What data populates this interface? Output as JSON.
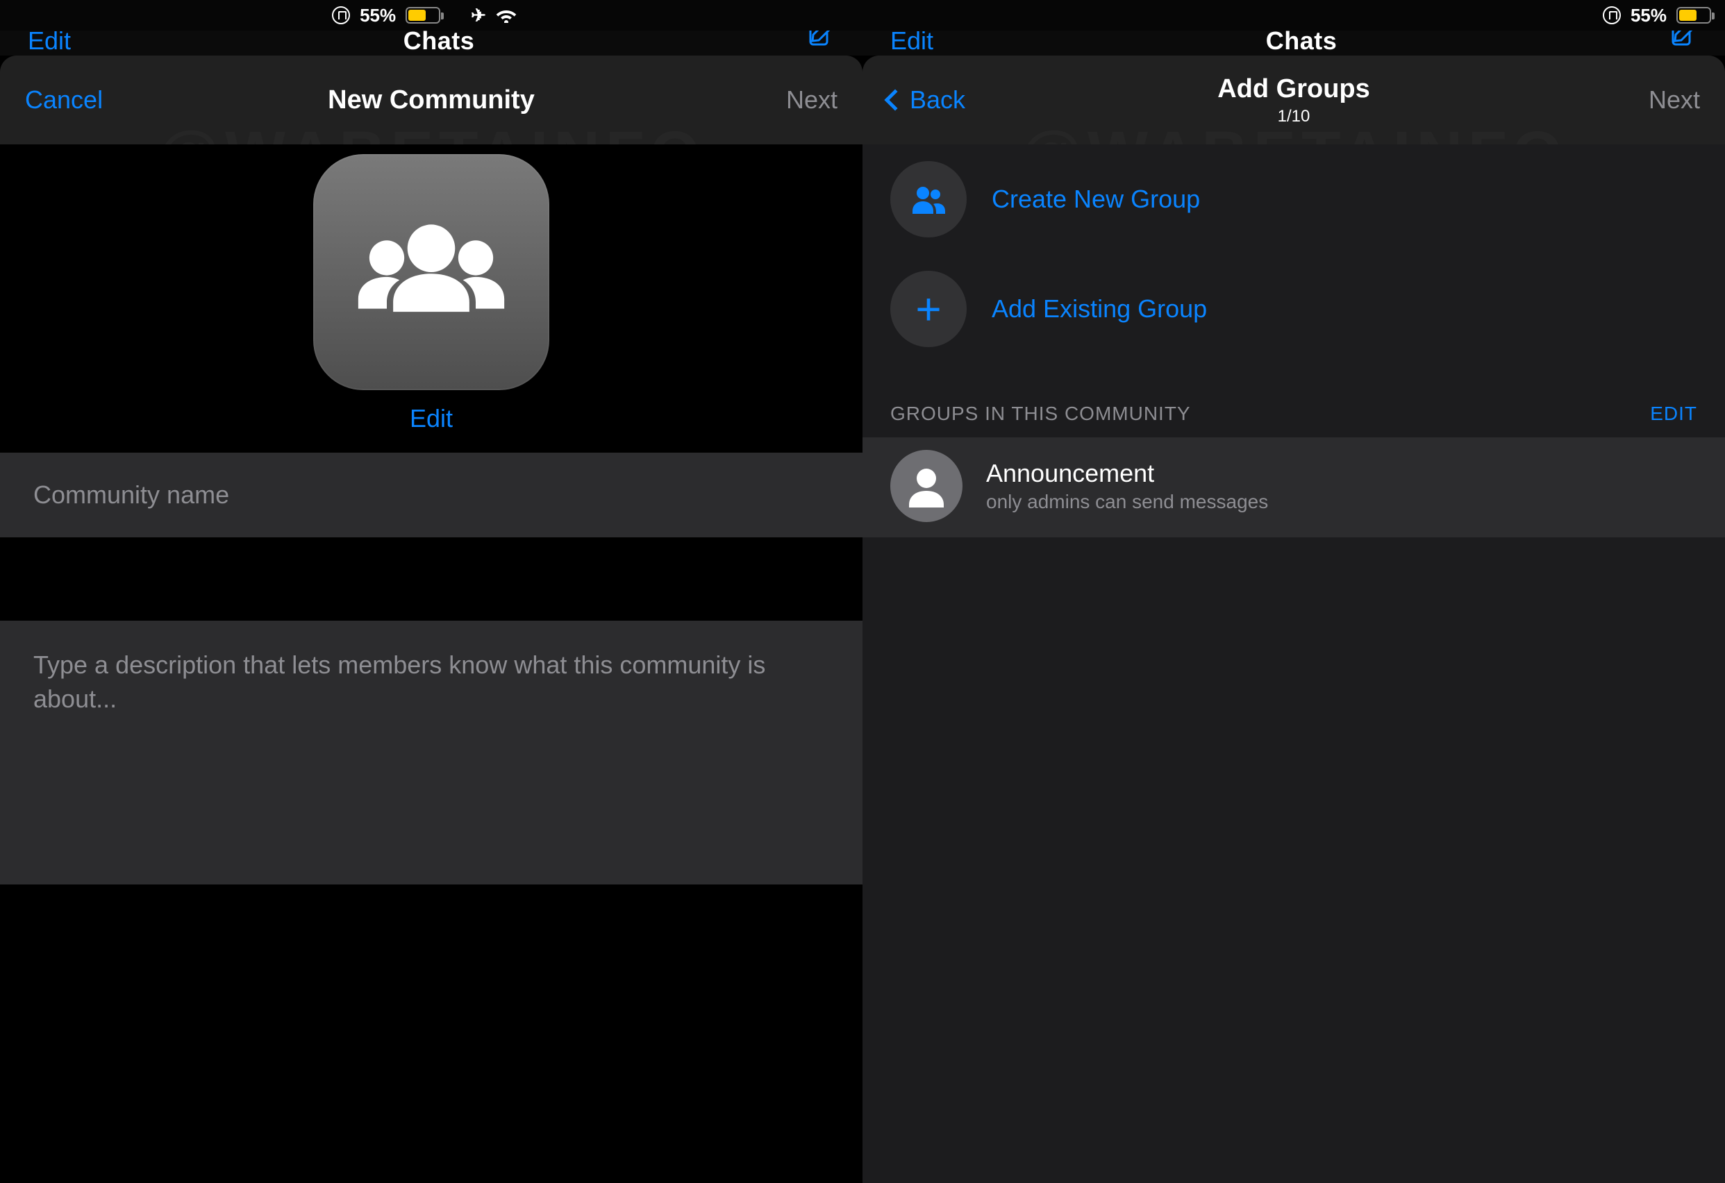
{
  "watermark": "@WABETAINFO",
  "status": {
    "battery_text": "55%",
    "battery_fill_pct": 55,
    "airplane": true,
    "wifi": true,
    "rotation_lock": true
  },
  "under": {
    "edit": "Edit",
    "title": "Chats"
  },
  "left": {
    "nav": {
      "cancel": "Cancel",
      "title": "New Community",
      "next": "Next"
    },
    "edit_photo": "Edit",
    "name_placeholder": "Community name",
    "desc_placeholder": "Type a description that lets members know what this community is about..."
  },
  "right": {
    "nav": {
      "back": "Back",
      "title": "Add Groups",
      "counter": "1/10",
      "next": "Next"
    },
    "actions": {
      "create": "Create New Group",
      "add_existing": "Add Existing Group"
    },
    "section": {
      "header": "GROUPS IN THIS COMMUNITY",
      "edit": "EDIT"
    },
    "groups": {
      "announcement": {
        "title": "Announcement",
        "sub": "only admins can send messages"
      }
    }
  }
}
